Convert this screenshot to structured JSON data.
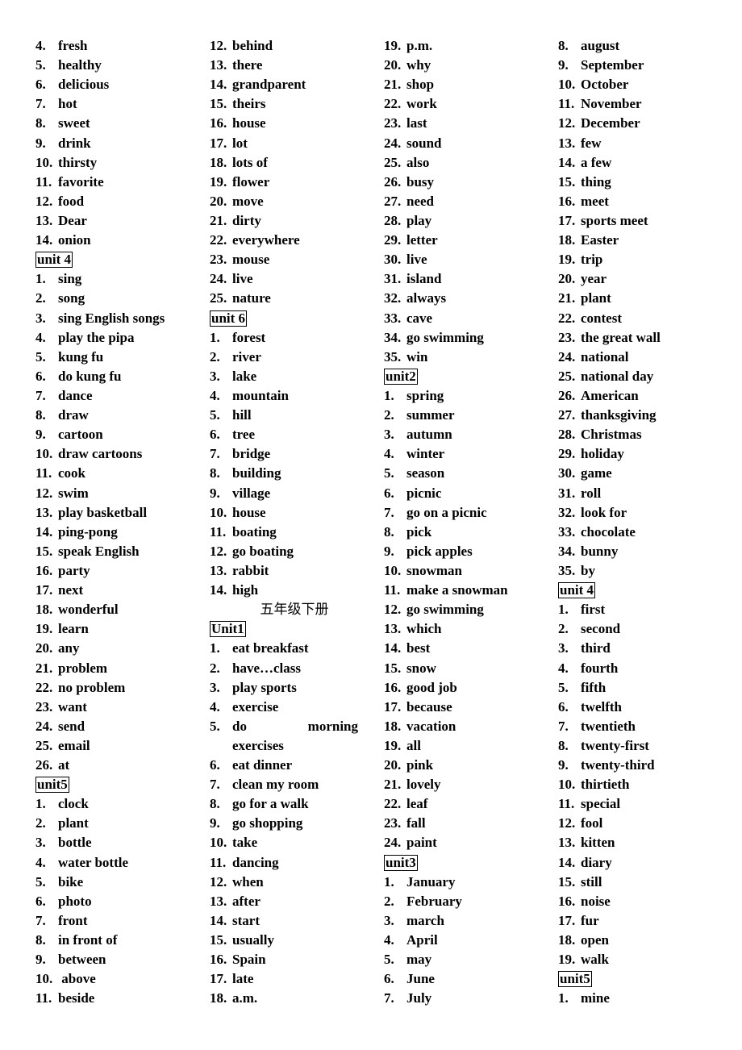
{
  "columns": [
    [
      {
        "n": "4.",
        "t": "fresh"
      },
      {
        "n": "5.",
        "t": "healthy"
      },
      {
        "n": "6.",
        "t": "delicious"
      },
      {
        "n": "7.",
        "t": "hot"
      },
      {
        "n": "8.",
        "t": "sweet"
      },
      {
        "n": "9.",
        "t": "drink"
      },
      {
        "n": "10.",
        "t": "thirsty"
      },
      {
        "n": "11.",
        "t": "favorite"
      },
      {
        "n": "12.",
        "t": "food"
      },
      {
        "n": "13.",
        "t": "Dear"
      },
      {
        "n": "14.",
        "t": "onion"
      },
      {
        "unit": "unit 4"
      },
      {
        "n": "1.",
        "t": "sing"
      },
      {
        "n": "2.",
        "t": "song"
      },
      {
        "n": "3.",
        "t": "sing English songs"
      },
      {
        "n": "4.",
        "t": "play the pipa"
      },
      {
        "n": "5.",
        "t": "kung fu"
      },
      {
        "n": "6.",
        "t": "do kung fu"
      },
      {
        "n": "7.",
        "t": "dance"
      },
      {
        "n": "8.",
        "t": "draw"
      },
      {
        "n": "9.",
        "t": "cartoon"
      },
      {
        "n": "10.",
        "t": "draw cartoons"
      },
      {
        "n": "11.",
        "t": "cook"
      },
      {
        "n": "12.",
        "t": "swim"
      },
      {
        "n": "13.",
        "t": "play basketball"
      },
      {
        "n": "14.",
        "t": "ping-pong"
      },
      {
        "n": "15.",
        "t": "speak English"
      },
      {
        "n": "16.",
        "t": "party"
      },
      {
        "n": "17.",
        "t": "next"
      },
      {
        "n": "18.",
        "t": "wonderful"
      },
      {
        "n": "19.",
        "t": "learn"
      },
      {
        "n": "20.",
        "t": "any"
      },
      {
        "n": "21.",
        "t": "problem"
      },
      {
        "n": "22.",
        "t": "no problem"
      },
      {
        "n": "23.",
        "t": "want"
      },
      {
        "n": "24.",
        "t": "send"
      },
      {
        "n": "25.",
        "t": "email"
      },
      {
        "n": "26.",
        "t": "at"
      },
      {
        "unit": "unit5"
      },
      {
        "n": "1.",
        "t": "clock"
      },
      {
        "n": "2.",
        "t": "plant"
      },
      {
        "n": "3.",
        "t": "bottle"
      },
      {
        "n": "4.",
        "t": "water bottle"
      },
      {
        "n": "5.",
        "t": "bike"
      },
      {
        "n": "6.",
        "t": "photo"
      },
      {
        "n": "7.",
        "t": "front"
      },
      {
        "n": "8.",
        "t": "in front of"
      },
      {
        "n": "9.",
        "t": "between"
      },
      {
        "n": "10.",
        "t": " above"
      },
      {
        "n": "11.",
        "t": "beside"
      }
    ],
    [
      {
        "n": "12.",
        "t": "behind"
      },
      {
        "n": "13.",
        "t": "there"
      },
      {
        "n": "14.",
        "t": "grandparent"
      },
      {
        "n": "15.",
        "t": "theirs"
      },
      {
        "n": "16.",
        "t": "house"
      },
      {
        "n": "17.",
        "t": "lot"
      },
      {
        "n": "18.",
        "t": "lots of"
      },
      {
        "n": "19.",
        "t": "flower"
      },
      {
        "n": "20.",
        "t": "move"
      },
      {
        "n": "21.",
        "t": "dirty"
      },
      {
        "n": "22.",
        "t": "everywhere"
      },
      {
        "n": "23.",
        "t": "mouse"
      },
      {
        "n": "24.",
        "t": "live"
      },
      {
        "n": "25.",
        "t": "nature"
      },
      {
        "unit": "unit 6"
      },
      {
        "n": "1.",
        "t": "forest"
      },
      {
        "n": "2.",
        "t": "river"
      },
      {
        "n": "3.",
        "t": "lake"
      },
      {
        "n": "4.",
        "t": "mountain"
      },
      {
        "n": "5.",
        "t": "hill"
      },
      {
        "n": "6.",
        "t": "tree"
      },
      {
        "n": "7.",
        "t": "bridge"
      },
      {
        "n": "8.",
        "t": "building"
      },
      {
        "n": "9.",
        "t": "village"
      },
      {
        "n": "10.",
        "t": "house"
      },
      {
        "n": "11.",
        "t": "boating"
      },
      {
        "n": "12.",
        "t": "go boating"
      },
      {
        "n": "13.",
        "t": "rabbit"
      },
      {
        "n": "14.",
        "t": "high"
      },
      {
        "heading": "五年级下册"
      },
      {
        "unit": "Unit1"
      },
      {
        "n": "1.",
        "t": "eat breakfast"
      },
      {
        "n": "2.",
        "t": "have…class"
      },
      {
        "n": "3.",
        "t": "play sports"
      },
      {
        "n": "4.",
        "t": "exercise"
      },
      {
        "n": "5.",
        "t": "do morning",
        "justify": true
      },
      {
        "cont": "exercises"
      },
      {
        "n": "6.",
        "t": "eat dinner"
      },
      {
        "n": "7.",
        "t": "clean my room"
      },
      {
        "n": "8.",
        "t": "go for a walk"
      },
      {
        "n": "9.",
        "t": "go shopping"
      },
      {
        "n": "10.",
        "t": "take"
      },
      {
        "n": "11.",
        "t": "dancing"
      },
      {
        "n": "12.",
        "t": "when"
      },
      {
        "n": "13.",
        "t": "after"
      },
      {
        "n": "14.",
        "t": "start"
      },
      {
        "n": "15.",
        "t": "usually"
      },
      {
        "n": "16.",
        "t": "Spain"
      },
      {
        "n": "17.",
        "t": "late"
      },
      {
        "n": "18.",
        "t": "a.m."
      }
    ],
    [
      {
        "n": "19.",
        "t": "p.m."
      },
      {
        "n": "20.",
        "t": "why"
      },
      {
        "n": "21.",
        "t": "shop"
      },
      {
        "n": "22.",
        "t": "work"
      },
      {
        "n": "23.",
        "t": "last"
      },
      {
        "n": "24.",
        "t": "sound"
      },
      {
        "n": "25.",
        "t": "also"
      },
      {
        "n": "26.",
        "t": "busy"
      },
      {
        "n": "27.",
        "t": "need"
      },
      {
        "n": "28.",
        "t": "play"
      },
      {
        "n": "29.",
        "t": "letter"
      },
      {
        "n": "30.",
        "t": "live"
      },
      {
        "n": "31.",
        "t": "island"
      },
      {
        "n": "32.",
        "t": "always"
      },
      {
        "n": "33.",
        "t": "cave"
      },
      {
        "n": "34.",
        "t": "go swimming"
      },
      {
        "n": "35.",
        "t": "win"
      },
      {
        "unit": "unit2"
      },
      {
        "n": "1.",
        "t": "spring"
      },
      {
        "n": "2.",
        "t": "summer"
      },
      {
        "n": "3.",
        "t": "autumn"
      },
      {
        "n": "4.",
        "t": "winter"
      },
      {
        "n": "5.",
        "t": "season"
      },
      {
        "n": "6.",
        "t": "picnic"
      },
      {
        "n": "7.",
        "t": "go on a picnic"
      },
      {
        "n": "8.",
        "t": "pick"
      },
      {
        "n": "9.",
        "t": "pick apples"
      },
      {
        "n": "10.",
        "t": "snowman"
      },
      {
        "n": "11.",
        "t": "make a snowman"
      },
      {
        "n": "12.",
        "t": "go swimming"
      },
      {
        "n": "13.",
        "t": "which"
      },
      {
        "n": "14.",
        "t": "best"
      },
      {
        "n": "15.",
        "t": "snow"
      },
      {
        "n": "16.",
        "t": "good job"
      },
      {
        "n": "17.",
        "t": "because"
      },
      {
        "n": "18.",
        "t": "vacation"
      },
      {
        "n": "19.",
        "t": "all"
      },
      {
        "n": "20.",
        "t": "pink"
      },
      {
        "n": "21.",
        "t": "lovely"
      },
      {
        "n": "22.",
        "t": "leaf"
      },
      {
        "n": "23.",
        "t": "fall"
      },
      {
        "n": "24.",
        "t": "paint"
      },
      {
        "unit": "unit3"
      },
      {
        "n": "1.",
        "t": "January"
      },
      {
        "n": "2.",
        "t": "February"
      },
      {
        "n": "3.",
        "t": "march"
      },
      {
        "n": "4.",
        "t": "April"
      },
      {
        "n": "5.",
        "t": "may"
      },
      {
        "n": "6.",
        "t": "June"
      },
      {
        "n": "7.",
        "t": "July"
      }
    ],
    [
      {
        "n": "8.",
        "t": "august"
      },
      {
        "n": "9.",
        "t": "September"
      },
      {
        "n": "10.",
        "t": "October"
      },
      {
        "n": "11.",
        "t": "November"
      },
      {
        "n": "12.",
        "t": "December"
      },
      {
        "n": "13.",
        "t": "few"
      },
      {
        "n": "14.",
        "t": "a few"
      },
      {
        "n": "15.",
        "t": "thing"
      },
      {
        "n": "16.",
        "t": "meet"
      },
      {
        "n": "17.",
        "t": "sports meet"
      },
      {
        "n": "18.",
        "t": "Easter"
      },
      {
        "n": "19.",
        "t": "trip"
      },
      {
        "n": "20.",
        "t": "year"
      },
      {
        "n": "21.",
        "t": "plant"
      },
      {
        "n": "22.",
        "t": "contest"
      },
      {
        "n": "23.",
        "t": "the great wall"
      },
      {
        "n": "24.",
        "t": "national"
      },
      {
        "n": "25.",
        "t": "national day"
      },
      {
        "n": "26.",
        "t": "American"
      },
      {
        "n": "27.",
        "t": "thanksgiving"
      },
      {
        "n": "28.",
        "t": "Christmas"
      },
      {
        "n": "29.",
        "t": "holiday"
      },
      {
        "n": "30.",
        "t": "game"
      },
      {
        "n": "31.",
        "t": "roll"
      },
      {
        "n": "32.",
        "t": "look for"
      },
      {
        "n": "33.",
        "t": "chocolate"
      },
      {
        "n": "34.",
        "t": "bunny"
      },
      {
        "n": "35.",
        "t": "by"
      },
      {
        "unit": "unit 4"
      },
      {
        "n": "1.",
        "t": "first"
      },
      {
        "n": "2.",
        "t": "second"
      },
      {
        "n": "3.",
        "t": "third"
      },
      {
        "n": "4.",
        "t": "fourth"
      },
      {
        "n": "5.",
        "t": "fifth"
      },
      {
        "n": "6.",
        "t": "twelfth"
      },
      {
        "n": "7.",
        "t": "twentieth"
      },
      {
        "n": "8.",
        "t": "twenty-first"
      },
      {
        "n": "9.",
        "t": "twenty-third"
      },
      {
        "n": "10.",
        "t": "thirtieth"
      },
      {
        "n": "11.",
        "t": "special"
      },
      {
        "n": "12.",
        "t": "fool"
      },
      {
        "n": "13.",
        "t": "kitten"
      },
      {
        "n": "14.",
        "t": "diary"
      },
      {
        "n": "15.",
        "t": "still"
      },
      {
        "n": "16.",
        "t": "noise"
      },
      {
        "n": "17.",
        "t": "fur"
      },
      {
        "n": "18.",
        "t": "open"
      },
      {
        "n": "19.",
        "t": "walk"
      },
      {
        "unit": "unit5"
      },
      {
        "n": "1.",
        "t": "mine"
      }
    ]
  ]
}
